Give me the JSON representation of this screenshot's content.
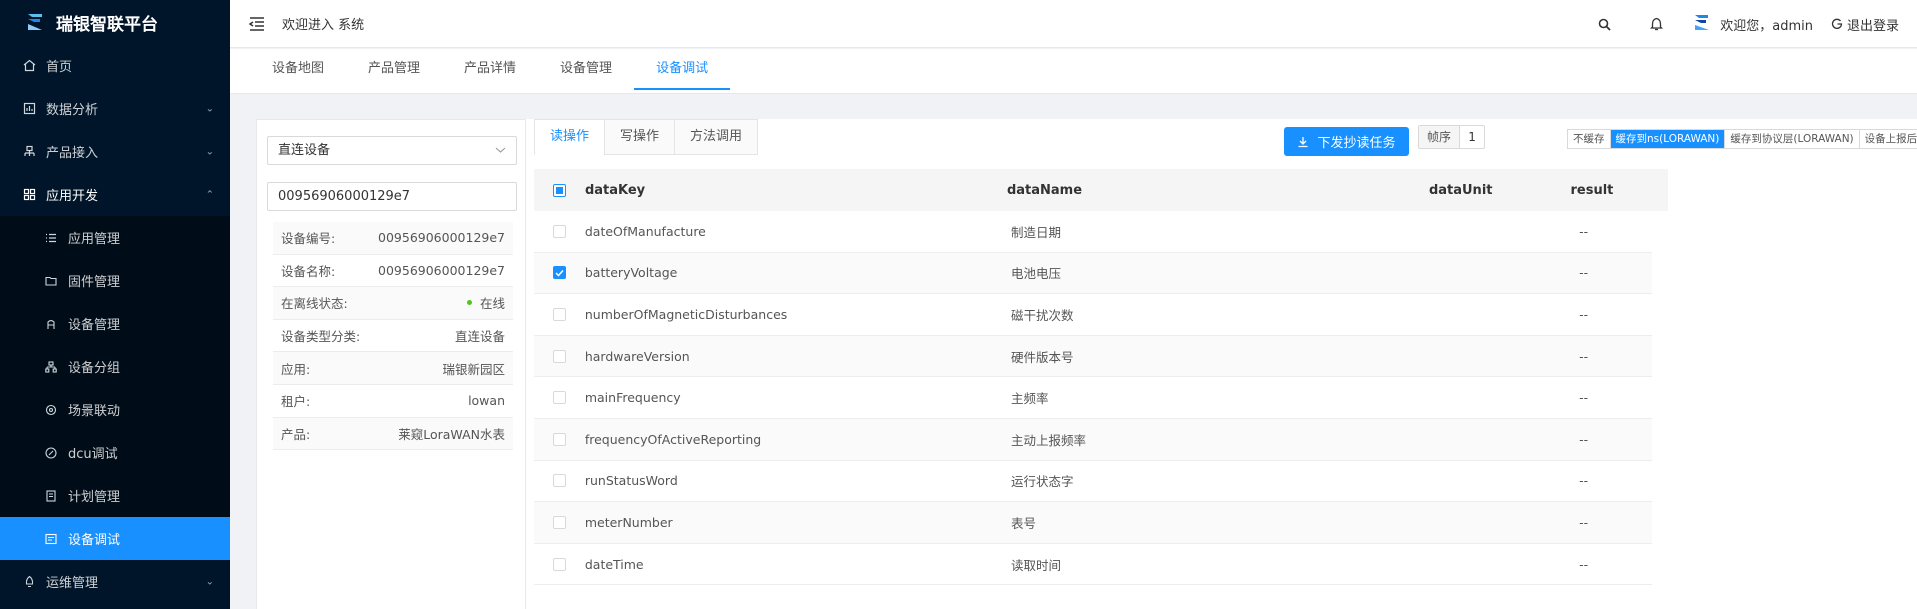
{
  "app": {
    "title": "瑞银智联平台"
  },
  "sidebar": {
    "items": [
      {
        "label": "首页",
        "icon": "home-icon"
      },
      {
        "label": "数据分析",
        "icon": "analysis-icon",
        "chevron": "down"
      },
      {
        "label": "产品接入",
        "icon": "product-icon",
        "chevron": "down"
      },
      {
        "label": "应用开发",
        "icon": "app-dev-icon",
        "chevron": "up"
      }
    ],
    "submenu": [
      {
        "label": "应用管理",
        "icon": "list-icon"
      },
      {
        "label": "固件管理",
        "icon": "folder-icon"
      },
      {
        "label": "设备管理",
        "icon": "device-icon"
      },
      {
        "label": "设备分组",
        "icon": "group-icon"
      },
      {
        "label": "场景联动",
        "icon": "scene-icon"
      },
      {
        "label": "dcu调试",
        "icon": "dcu-icon"
      },
      {
        "label": "计划管理",
        "icon": "plan-icon"
      },
      {
        "label": "设备调试",
        "icon": "debug-icon"
      }
    ],
    "after": [
      {
        "label": "运维管理",
        "icon": "ops-icon",
        "chevron": "down"
      }
    ]
  },
  "header": {
    "welcome": "欢迎进入 系统",
    "user_greeting": "欢迎您，admin",
    "logout_label": "退出登录"
  },
  "tabs": [
    {
      "label": "设备地图"
    },
    {
      "label": "产品管理"
    },
    {
      "label": "产品详情"
    },
    {
      "label": "设备管理"
    },
    {
      "label": "设备调试"
    }
  ],
  "device": {
    "type_select": "直连设备",
    "id_input": "00956906000129e7",
    "info": [
      {
        "label": "设备编号:",
        "value": "00956906000129e7"
      },
      {
        "label": "设备名称:",
        "value": "00956906000129e7"
      },
      {
        "label": "在离线状态:",
        "value": "在线"
      },
      {
        "label": "设备类型分类:",
        "value": "直连设备"
      },
      {
        "label": "应用:",
        "value": "瑞银新园区"
      },
      {
        "label": "租户:",
        "value": "lowan"
      },
      {
        "label": "产品:",
        "value": "莱窥LoraWAN水表"
      }
    ]
  },
  "op_tabs": [
    {
      "label": "读操作"
    },
    {
      "label": "写操作"
    },
    {
      "label": "方法调用"
    }
  ],
  "toolbar": {
    "dispatch_label": "下发抄读任务",
    "seq_label": "帧序",
    "seq_value": "1",
    "cache_options": [
      "不缓存",
      "缓存到ns(LORAWAN)",
      "缓存到协议层(LORAWAN)",
      "设备上报后下发"
    ],
    "cache_selected": 1
  },
  "table": {
    "columns": [
      "dataKey",
      "dataName",
      "dataUnit",
      "result"
    ],
    "rows": [
      {
        "key": "dateOfManufacture",
        "name": "制造日期",
        "unit": "",
        "result": "--",
        "checked": false
      },
      {
        "key": "batteryVoltage",
        "name": "电池电压",
        "unit": "",
        "result": "--",
        "checked": true
      },
      {
        "key": "numberOfMagneticDisturbances",
        "name": "磁干扰次数",
        "unit": "",
        "result": "--",
        "checked": false
      },
      {
        "key": "hardwareVersion",
        "name": "硬件版本号",
        "unit": "",
        "result": "--",
        "checked": false
      },
      {
        "key": "mainFrequency",
        "name": "主频率",
        "unit": "",
        "result": "--",
        "checked": false
      },
      {
        "key": "frequencyOfActiveReporting",
        "name": "主动上报频率",
        "unit": "",
        "result": "--",
        "checked": false
      },
      {
        "key": "runStatusWord",
        "name": "运行状态字",
        "unit": "",
        "result": "--",
        "checked": false
      },
      {
        "key": "meterNumber",
        "name": "表号",
        "unit": "",
        "result": "--",
        "checked": false
      },
      {
        "key": "dateTime",
        "name": "读取时间",
        "unit": "",
        "result": "--",
        "checked": false
      }
    ]
  },
  "colors": {
    "accent": "#1890ff",
    "sidebar_bg": "#001529",
    "online": "#52c41a"
  }
}
